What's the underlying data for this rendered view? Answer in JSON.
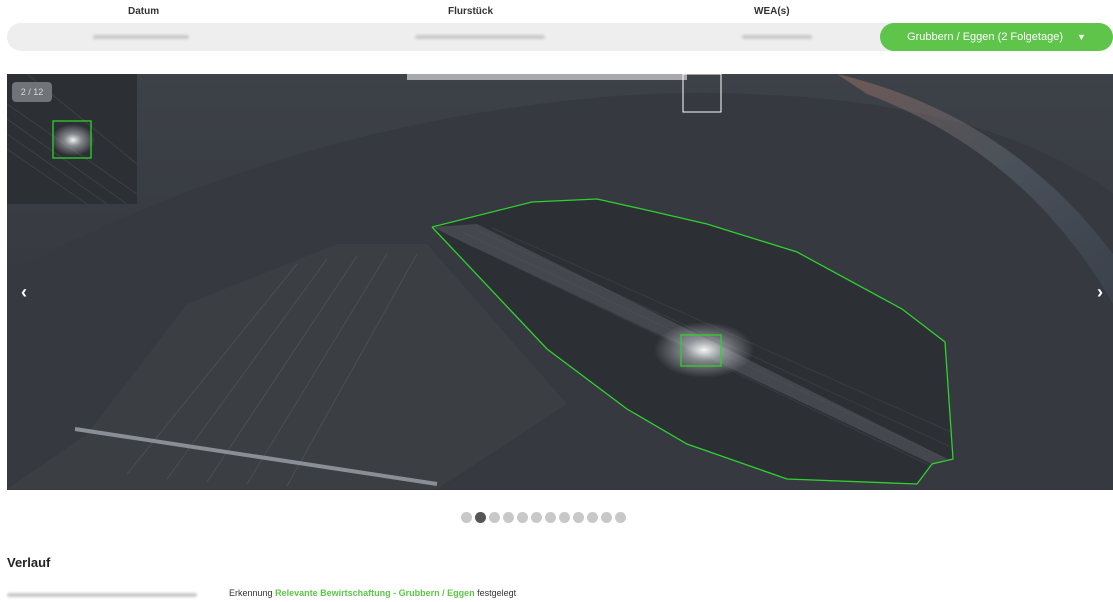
{
  "header": {
    "col_date": "Datum",
    "col_parcel": "Flurstück",
    "col_wea": "WEA(s)"
  },
  "action_select": {
    "label": "Grubbern / Eggen (2 Folgetage)",
    "accent_color": "#5ec54a"
  },
  "viewer": {
    "counter": "2 / 12",
    "prev_icon": "‹",
    "next_icon": "›",
    "detection_color": "#2fd12f"
  },
  "pagination": {
    "total": 12,
    "active_index": 1
  },
  "history": {
    "title": "Verlauf",
    "entry_prefix": "Erkennung",
    "entry_highlight": "Relevante Bewirtschaftung - Grubbern / Eggen",
    "entry_suffix": "festgelegt"
  }
}
